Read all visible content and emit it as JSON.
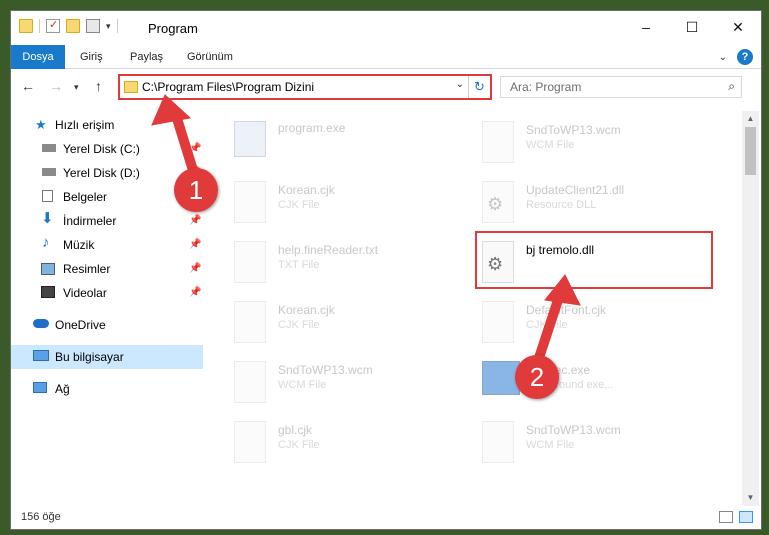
{
  "window": {
    "title": "Program",
    "controls": {
      "minimize": "–",
      "maximize": "☐",
      "close": "✕"
    }
  },
  "ribbon": {
    "tabs": [
      {
        "label": "Dosya"
      },
      {
        "label": "Giriş"
      },
      {
        "label": "Paylaş"
      },
      {
        "label": "Görünüm"
      }
    ],
    "help": "?"
  },
  "address": {
    "path": "C:\\Program Files\\Program Dizini",
    "refresh": "↻",
    "search_placeholder": "Ara: Program"
  },
  "nav": {
    "items": [
      {
        "label": "Hızlı erişim",
        "icon": "star-icon"
      },
      {
        "label": "Yerel Disk (C:)",
        "icon": "drive-icon"
      },
      {
        "label": "Yerel Disk (D:)",
        "icon": "drive-icon"
      },
      {
        "label": "Belgeler",
        "icon": "document-icon"
      },
      {
        "label": "İndirmeler",
        "icon": "download-icon"
      },
      {
        "label": "Müzik",
        "icon": "music-icon"
      },
      {
        "label": "Resimler",
        "icon": "picture-icon"
      },
      {
        "label": "Videolar",
        "icon": "video-icon"
      },
      {
        "label": "OneDrive",
        "icon": "cloud-icon"
      },
      {
        "label": "Bu bilgisayar",
        "icon": "computer-icon"
      },
      {
        "label": "Ağ",
        "icon": "network-icon"
      }
    ]
  },
  "files": [
    {
      "name": "program.exe",
      "type": ""
    },
    {
      "name": "SndToWP13.wcm",
      "type": "WCM File"
    },
    {
      "name": "Korean.cjk",
      "type": "CJK File"
    },
    {
      "name": "UpdateClient21.dll",
      "type": "Resource DLL"
    },
    {
      "name": "help.fineReader.txt",
      "type": "TXT File"
    },
    {
      "name": "bj tremolo.dll",
      "type": ""
    },
    {
      "name": "Korean.cjk",
      "type": "CJK File"
    },
    {
      "name": "DefaultFont.cjk",
      "type": "CJK File"
    },
    {
      "name": "SndToWP13.wcm",
      "type": "WCM File"
    },
    {
      "name": "BgExec.exe",
      "type": "background exe..."
    },
    {
      "name": "gbl.cjk",
      "type": "CJK File"
    },
    {
      "name": "SndToWP13.wcm",
      "type": "WCM File"
    }
  ],
  "status": {
    "item_count": "156 öğe"
  },
  "callouts": {
    "one": "1",
    "two": "2"
  },
  "colors": {
    "accent": "#1979ca",
    "highlight": "#e03a3a",
    "selected": "#cce8ff"
  }
}
